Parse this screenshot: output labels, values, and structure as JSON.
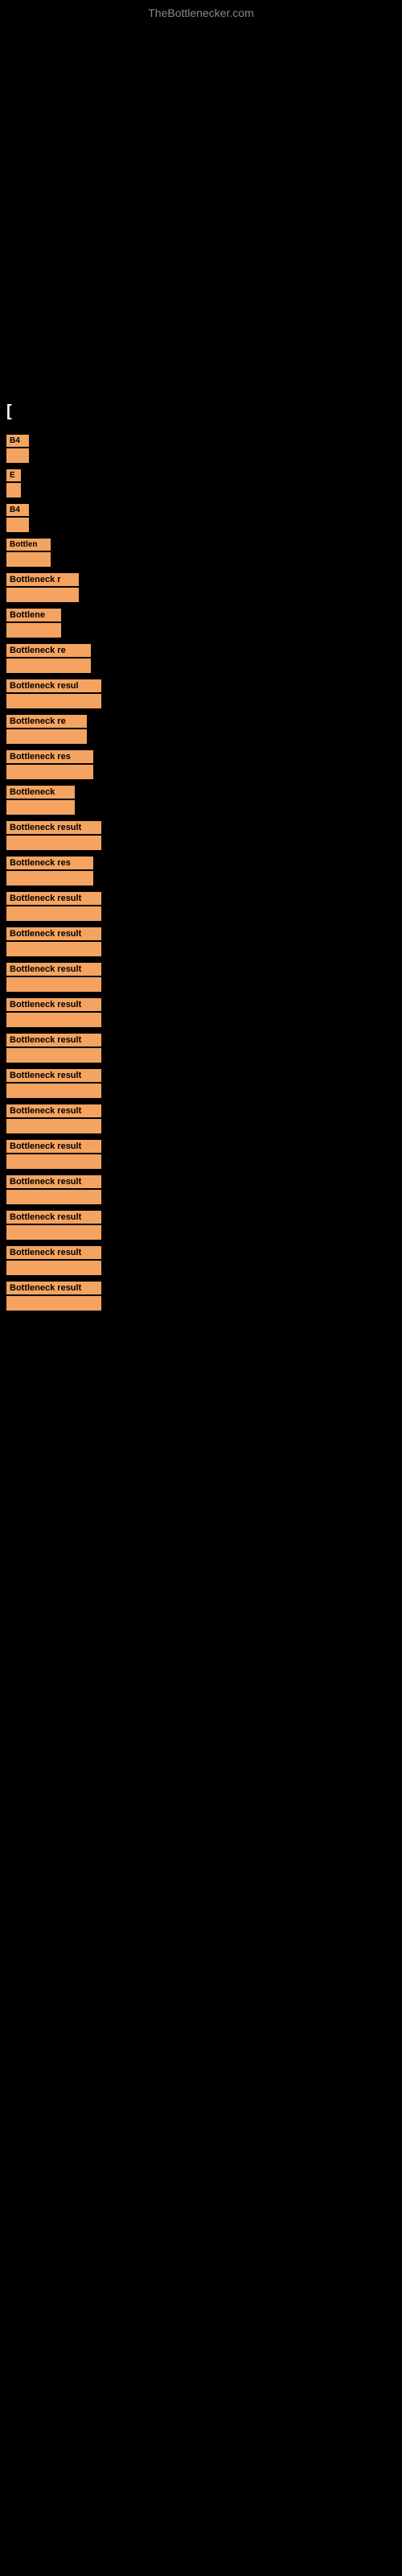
{
  "site": {
    "title": "TheBottlenecker.com"
  },
  "bracket": {
    "label": "["
  },
  "items": [
    {
      "id": 1,
      "label": "B4",
      "short": "B4"
    },
    {
      "id": 2,
      "label": "E",
      "short": "E"
    },
    {
      "id": 3,
      "label": "B4",
      "short": "B4"
    },
    {
      "id": 4,
      "label": "Bottlen",
      "short": "Bottlen"
    },
    {
      "id": 5,
      "label": "Bottleneck r",
      "short": "Bottleneck r"
    },
    {
      "id": 6,
      "label": "Bottlene",
      "short": "Bottlene"
    },
    {
      "id": 7,
      "label": "Bottleneck re",
      "short": "Bottleneck re"
    },
    {
      "id": 8,
      "label": "Bottleneck resul",
      "short": "Bottleneck resul"
    },
    {
      "id": 9,
      "label": "Bottleneck re",
      "short": "Bottleneck re"
    },
    {
      "id": 10,
      "label": "Bottleneck res",
      "short": "Bottleneck res"
    },
    {
      "id": 11,
      "label": "Bottleneck",
      "short": "Bottleneck"
    },
    {
      "id": 12,
      "label": "Bottleneck result",
      "short": "Bottleneck result"
    },
    {
      "id": 13,
      "label": "Bottleneck res",
      "short": "Bottleneck res"
    },
    {
      "id": 14,
      "label": "Bottleneck result",
      "short": "Bottleneck result"
    },
    {
      "id": 15,
      "label": "Bottleneck result",
      "short": "Bottleneck result"
    },
    {
      "id": 16,
      "label": "Bottleneck result",
      "short": "Bottleneck result"
    },
    {
      "id": 17,
      "label": "Bottleneck result",
      "short": "Bottleneck result"
    },
    {
      "id": 18,
      "label": "Bottleneck result",
      "short": "Bottleneck result"
    },
    {
      "id": 19,
      "label": "Bottleneck result",
      "short": "Bottleneck result"
    },
    {
      "id": 20,
      "label": "Bottleneck result",
      "short": "Bottleneck result"
    },
    {
      "id": 21,
      "label": "Bottleneck result",
      "short": "Bottleneck result"
    },
    {
      "id": 22,
      "label": "Bottleneck result",
      "short": "Bottleneck result"
    },
    {
      "id": 23,
      "label": "Bottleneck result",
      "short": "Bottleneck result"
    },
    {
      "id": 24,
      "label": "Bottleneck result",
      "short": "Bottleneck result"
    },
    {
      "id": 25,
      "label": "Bottleneck result",
      "short": "Bottleneck result"
    }
  ],
  "colors": {
    "background": "#000000",
    "bar_color": "#F4A460",
    "text_dark": "#000000",
    "text_light": "#ffffff",
    "site_title_color": "#888888"
  }
}
